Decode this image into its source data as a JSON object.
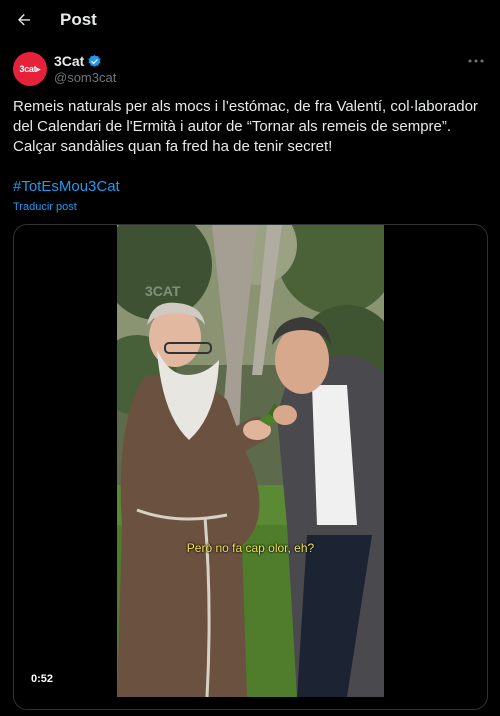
{
  "header": {
    "title": "Post",
    "back_icon": "arrow-left-icon"
  },
  "author": {
    "avatar_text": "3cat▸",
    "display_name": "3Cat",
    "handle": "@som3cat",
    "verified_icon": "verified-badge-icon",
    "avatar_color": "#e6223a",
    "verified_color": "#1d9bf0"
  },
  "post": {
    "text": "Remeis naturals per als mocs i l’estómac, de fra Valentí, col·laborador del Calendari de l'Ermità i autor de “Tornar als remeis de sempre”. Calçar sandàlies quan fa fred ha de tenir secret!",
    "hashtag": "#TotEsMou3Cat",
    "translate_label": "Traducir post"
  },
  "media": {
    "watermark": "3CAT",
    "subtitle": "Però no fa cap olor, eh?",
    "duration": "0:52"
  },
  "colors": {
    "background": "#000000",
    "text": "#e7e9ea",
    "muted": "#71767b",
    "link": "#1d9bf0",
    "border": "#2f3336"
  }
}
